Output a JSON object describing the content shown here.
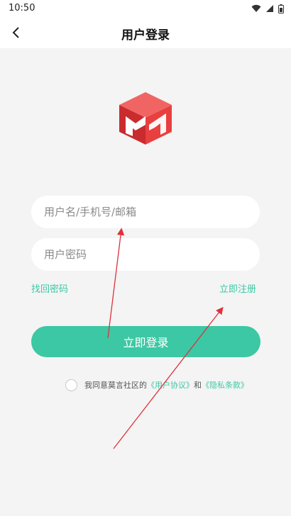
{
  "status_bar": {
    "time": "10:50",
    "icons": [
      "wifi-icon",
      "signal-icon",
      "battery-icon"
    ]
  },
  "nav": {
    "back_icon": "chevron-left-icon",
    "title": "用户登录"
  },
  "logo": {
    "icon": "app-logo-icon",
    "colors": [
      "#e8403f",
      "#c92b2e",
      "#f06563"
    ]
  },
  "form": {
    "username_placeholder": "用户名/手机号/邮箱",
    "password_placeholder": "用户密码",
    "forgot_label": "找回密码",
    "register_label": "立即注册",
    "login_label": "立即登录"
  },
  "agreement": {
    "prefix": "我同意莫言社区的",
    "user_agreement": "《用户协议》",
    "conjunction": "和",
    "privacy_policy": "《隐私条款》",
    "checked": false
  },
  "colors": {
    "accent": "#3cc8a4",
    "background": "#f4f4f4",
    "annotation_arrow": "#e0303a"
  }
}
